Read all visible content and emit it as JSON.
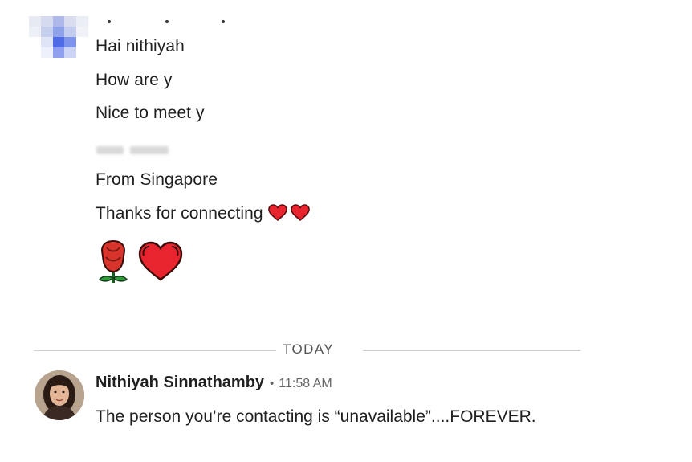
{
  "conversation": {
    "previous_messages": [
      "Hai nithiyah",
      "How are y",
      "Nice to meet y"
    ],
    "from_line": "From Singapore",
    "thanks_line": "Thanks for connecting",
    "thanks_emojis": [
      "heart-emoji",
      "heart-emoji"
    ],
    "emoji_message": [
      "rose-emoji",
      "heart-emoji"
    ]
  },
  "divider": {
    "label": "TODAY"
  },
  "last_message": {
    "sender_name": "Nithiyah Sinnathamby",
    "separator": "•",
    "time": "11:58 AM",
    "text": "The person you’re contacting is “unavailable”....FOREVER."
  },
  "colors": {
    "heart": "#e8242f",
    "rose_petal": "#d9342b",
    "rose_leaf": "#2f9e3a",
    "divider": "#cfcfcf",
    "meta_text": "#666666"
  }
}
